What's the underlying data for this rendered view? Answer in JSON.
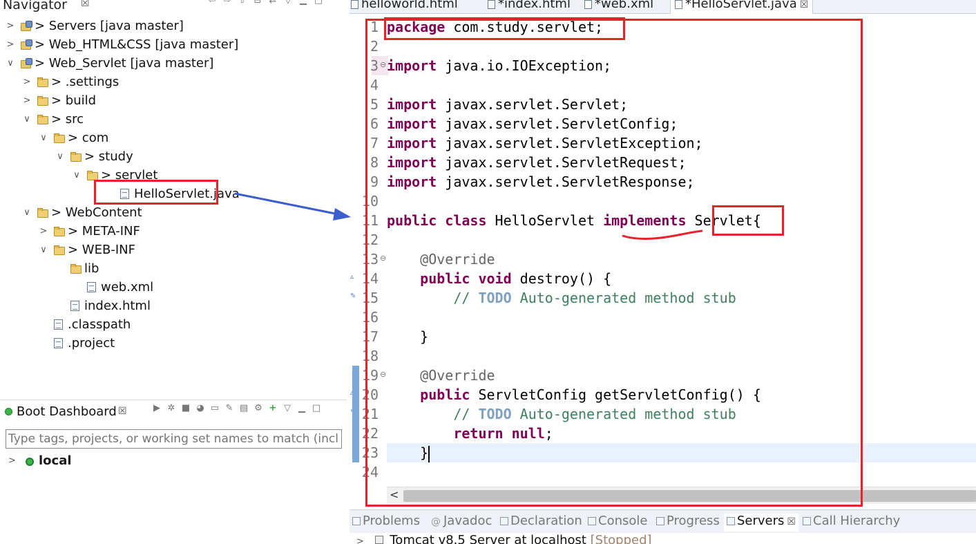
{
  "navigator": {
    "title": "Navigator",
    "close_label": "☒",
    "tree": [
      {
        "label": "> Servers [java master]",
        "type": "project",
        "depth": 0,
        "expanded": false
      },
      {
        "label": "> Web_HTML&CSS [java master]",
        "type": "project",
        "depth": 0,
        "expanded": false
      },
      {
        "label": "> Web_Servlet [java master]",
        "type": "project",
        "depth": 0,
        "expanded": true
      },
      {
        "label": "> .settings",
        "type": "folder",
        "depth": 1,
        "expanded": false
      },
      {
        "label": "> build",
        "type": "folder",
        "depth": 1,
        "expanded": false
      },
      {
        "label": "> src",
        "type": "folder",
        "depth": 1,
        "expanded": true
      },
      {
        "label": "> com",
        "type": "folder",
        "depth": 2,
        "expanded": true
      },
      {
        "label": "> study",
        "type": "folder",
        "depth": 3,
        "expanded": true
      },
      {
        "label": "> servlet",
        "type": "folder",
        "depth": 4,
        "expanded": true
      },
      {
        "label": "HelloServlet.java",
        "type": "file",
        "depth": 5,
        "expanded": null
      },
      {
        "label": "> WebContent",
        "type": "folder",
        "depth": 1,
        "expanded": true
      },
      {
        "label": "> META-INF",
        "type": "folder",
        "depth": 2,
        "expanded": false
      },
      {
        "label": "> WEB-INF",
        "type": "folder",
        "depth": 2,
        "expanded": true
      },
      {
        "label": "lib",
        "type": "folder",
        "depth": 3,
        "expanded": null
      },
      {
        "label": "web.xml",
        "type": "file",
        "depth": 3,
        "expanded": null
      },
      {
        "label": "index.html",
        "type": "file",
        "depth": 2,
        "expanded": null
      },
      {
        "label": ".classpath",
        "type": "file",
        "depth": 1,
        "expanded": null
      },
      {
        "label": ".project",
        "type": "file",
        "depth": 1,
        "expanded": null
      }
    ]
  },
  "boot_dashboard": {
    "title": "Boot Dashboard",
    "close_label": "☒",
    "filter_placeholder": "Type tags, projects, or working set names to match (incl.",
    "local_label": "local"
  },
  "editor": {
    "tabs": [
      {
        "label": "helloworld.html",
        "active": false
      },
      {
        "label": "*index.html",
        "active": false
      },
      {
        "label": "*web.xml",
        "active": false
      },
      {
        "label": "*HelloServlet.java",
        "active": true
      }
    ],
    "tab_close_label": "☒",
    "scroll_left_label": "<",
    "lines": [
      {
        "n": "1",
        "segments": [
          {
            "t": "package",
            "c": "kw"
          },
          {
            "t": " com.study.servlet;",
            "c": ""
          }
        ]
      },
      {
        "n": "2",
        "segments": []
      },
      {
        "n": "3",
        "segments": [
          {
            "t": "import",
            "c": "kw"
          },
          {
            "t": " java.io.IOException;",
            "c": ""
          }
        ]
      },
      {
        "n": "4",
        "segments": []
      },
      {
        "n": "5",
        "segments": [
          {
            "t": "import",
            "c": "kw"
          },
          {
            "t": " javax.servlet.Servlet;",
            "c": ""
          }
        ]
      },
      {
        "n": "6",
        "segments": [
          {
            "t": "import",
            "c": "kw"
          },
          {
            "t": " javax.servlet.ServletConfig;",
            "c": ""
          }
        ]
      },
      {
        "n": "7",
        "segments": [
          {
            "t": "import",
            "c": "kw"
          },
          {
            "t": " javax.servlet.ServletException;",
            "c": ""
          }
        ]
      },
      {
        "n": "8",
        "segments": [
          {
            "t": "import",
            "c": "kw"
          },
          {
            "t": " javax.servlet.ServletRequest;",
            "c": ""
          }
        ]
      },
      {
        "n": "9",
        "segments": [
          {
            "t": "import",
            "c": "kw"
          },
          {
            "t": " javax.servlet.ServletResponse;",
            "c": ""
          }
        ]
      },
      {
        "n": "10",
        "segments": []
      },
      {
        "n": "11",
        "segments": [
          {
            "t": "public",
            "c": "kw"
          },
          {
            "t": " ",
            "c": ""
          },
          {
            "t": "class",
            "c": "kw"
          },
          {
            "t": " HelloServlet ",
            "c": ""
          },
          {
            "t": "implements",
            "c": "kw"
          },
          {
            "t": " Servlet{",
            "c": ""
          }
        ]
      },
      {
        "n": "12",
        "segments": []
      },
      {
        "n": "13",
        "segments": [
          {
            "t": "    @Override",
            "c": "ann"
          }
        ]
      },
      {
        "n": "14",
        "segments": [
          {
            "t": "    ",
            "c": ""
          },
          {
            "t": "public",
            "c": "kw"
          },
          {
            "t": " ",
            "c": ""
          },
          {
            "t": "void",
            "c": "kw"
          },
          {
            "t": " destroy() {",
            "c": ""
          }
        ]
      },
      {
        "n": "15",
        "segments": [
          {
            "t": "        // ",
            "c": "cm"
          },
          {
            "t": "TODO",
            "c": "todo"
          },
          {
            "t": " Auto-generated method stub",
            "c": "cm"
          }
        ]
      },
      {
        "n": "16",
        "segments": []
      },
      {
        "n": "17",
        "segments": [
          {
            "t": "    }",
            "c": ""
          }
        ]
      },
      {
        "n": "18",
        "segments": []
      },
      {
        "n": "19",
        "segments": [
          {
            "t": "    @Override",
            "c": "ann"
          }
        ]
      },
      {
        "n": "20",
        "segments": [
          {
            "t": "    ",
            "c": ""
          },
          {
            "t": "public",
            "c": "kw"
          },
          {
            "t": " ServletConfig getServletConfig() {",
            "c": ""
          }
        ]
      },
      {
        "n": "21",
        "segments": [
          {
            "t": "        // ",
            "c": "cm"
          },
          {
            "t": "TODO",
            "c": "todo"
          },
          {
            "t": " Auto-generated method stub",
            "c": "cm"
          }
        ]
      },
      {
        "n": "22",
        "segments": [
          {
            "t": "        ",
            "c": ""
          },
          {
            "t": "return",
            "c": "kw"
          },
          {
            "t": " ",
            "c": ""
          },
          {
            "t": "null",
            "c": "kw"
          },
          {
            "t": ";",
            "c": ""
          }
        ]
      },
      {
        "n": "23",
        "segments": [
          {
            "t": "    }",
            "c": ""
          }
        ],
        "current": true
      },
      {
        "n": "24",
        "segments": []
      }
    ],
    "folded_lines": [
      "3",
      "13",
      "19"
    ],
    "override_marker_lines": [
      "14",
      "20"
    ],
    "task_marker_lines": [
      "15",
      "21"
    ],
    "occurrence_marker_lines": [
      "19",
      "20",
      "21",
      "22",
      "23"
    ]
  },
  "bottom_views": {
    "tabs": [
      {
        "label": "Problems",
        "active": false
      },
      {
        "label": "Javadoc",
        "active": false
      },
      {
        "label": "Declaration",
        "active": false
      },
      {
        "label": "Console",
        "active": false
      },
      {
        "label": "Progress",
        "active": false
      },
      {
        "label": "Servers",
        "active": true
      },
      {
        "label": "Call Hierarchy",
        "active": false
      }
    ],
    "close_label": "☒",
    "server_name": "Tomcat v8.5 Server at localhost",
    "server_status": "[Stopped]"
  },
  "colors": {
    "keyword": "#7f0055",
    "comment": "#3f7f5f",
    "annotation": "#646464",
    "todo": "#7f9fbf",
    "highlight_box": "#e8212b",
    "arrow": "#3a5fcd",
    "current_line": "#e8f2fe"
  }
}
